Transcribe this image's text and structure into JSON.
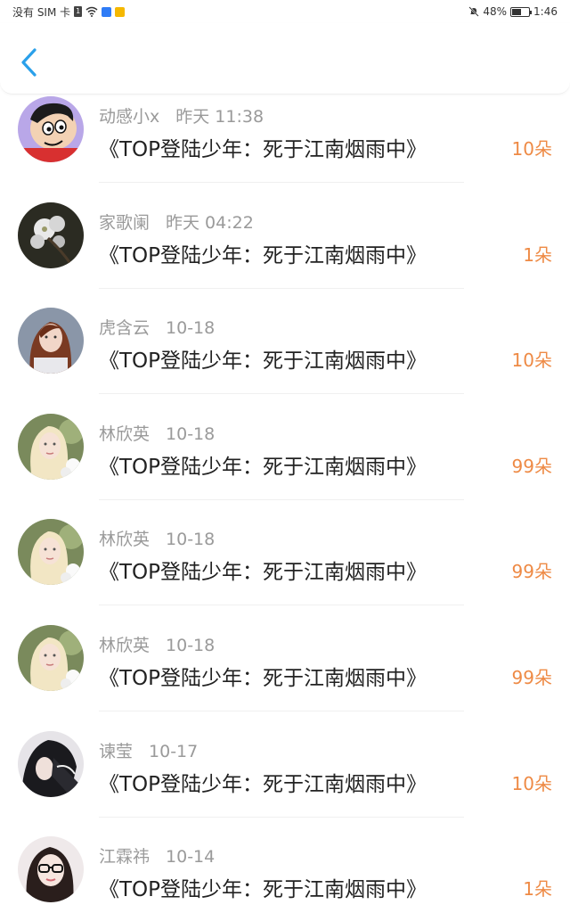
{
  "status_bar": {
    "carrier": "没有 SIM 卡",
    "sim_badge": "1",
    "battery_percent": "48%",
    "battery_level": 0.48,
    "time": "1:46",
    "app_badge_colors": [
      "#2f7cf6",
      "#f5b800"
    ]
  },
  "header": {
    "back_icon": "chevron-left-icon",
    "accent": "#2aa0ea"
  },
  "colors": {
    "count": "#ee8a45",
    "meta": "#9a9a9a",
    "title": "#222222"
  },
  "rows": [
    {
      "name": "动感小x",
      "time": "昨天 11:38",
      "title": "《TOP登陆少年：死于江南烟雨中》",
      "count": "10朵",
      "avatar": "cartoon-avatar"
    },
    {
      "name": "家歌阑",
      "time": "昨天 04:22",
      "title": "《TOP登陆少年：死于江南烟雨中》",
      "count": "1朵",
      "avatar": "flower-avatar"
    },
    {
      "name": "虎含云",
      "time": "10-18",
      "title": "《TOP登陆少年：死于江南烟雨中》",
      "count": "10朵",
      "avatar": "portrait-avatar"
    },
    {
      "name": "林欣英",
      "time": "10-18",
      "title": "《TOP登陆少年：死于江南烟雨中》",
      "count": "99朵",
      "avatar": "blonde-avatar"
    },
    {
      "name": "林欣英",
      "time": "10-18",
      "title": "《TOP登陆少年：死于江南烟雨中》",
      "count": "99朵",
      "avatar": "blonde-avatar"
    },
    {
      "name": "林欣英",
      "time": "10-18",
      "title": "《TOP登陆少年：死于江南烟雨中》",
      "count": "99朵",
      "avatar": "blonde-avatar"
    },
    {
      "name": "谏莹",
      "time": "10-17",
      "title": "《TOP登陆少年：死于江南烟雨中》",
      "count": "10朵",
      "avatar": "dark-hair-avatar"
    },
    {
      "name": "江霖祎",
      "time": "10-14",
      "title": "《TOP登陆少年：死于江南烟雨中》",
      "count": "1朵",
      "avatar": "glasses-avatar"
    }
  ]
}
